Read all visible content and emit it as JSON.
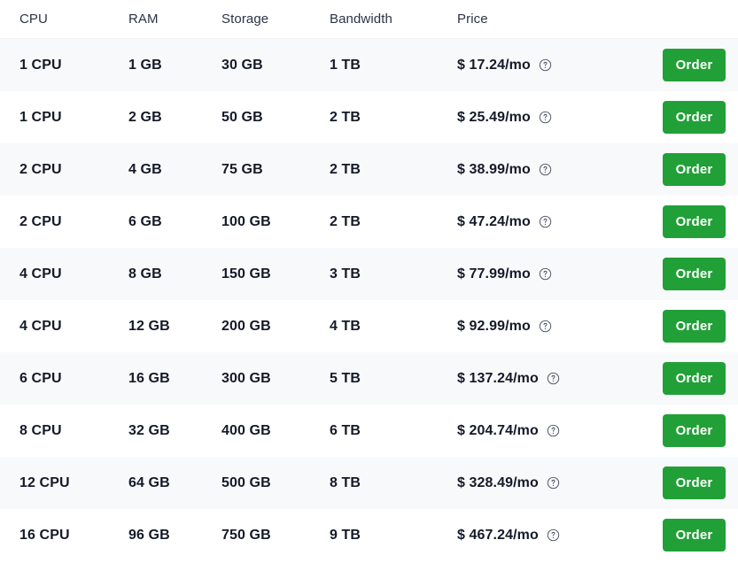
{
  "table": {
    "columns": [
      {
        "key": "cpu",
        "label": "CPU"
      },
      {
        "key": "ram",
        "label": "RAM"
      },
      {
        "key": "storage",
        "label": "Storage"
      },
      {
        "key": "bandwidth",
        "label": "Bandwidth"
      },
      {
        "key": "price",
        "label": "Price"
      }
    ],
    "action_label": "Order",
    "help_icon": "help-circle-icon",
    "currency_symbol": "$",
    "price_period": "/mo",
    "accent_color": "#21a038",
    "stripe_color": "#f8f9fa",
    "header_text_color": "#2b3445",
    "cell_text_color": "#151a28",
    "rows": [
      {
        "cpu": "1 CPU",
        "ram": "1 GB",
        "storage": "30 GB",
        "bandwidth": "1 TB",
        "price": "$ 17.24/mo",
        "price_value": "17.24",
        "action": "Order"
      },
      {
        "cpu": "1 CPU",
        "ram": "2 GB",
        "storage": "50 GB",
        "bandwidth": "2 TB",
        "price": "$ 25.49/mo",
        "price_value": "25.49",
        "action": "Order"
      },
      {
        "cpu": "2 CPU",
        "ram": "4 GB",
        "storage": "75 GB",
        "bandwidth": "2 TB",
        "price": "$ 38.99/mo",
        "price_value": "38.99",
        "action": "Order"
      },
      {
        "cpu": "2 CPU",
        "ram": "6 GB",
        "storage": "100 GB",
        "bandwidth": "2 TB",
        "price": "$ 47.24/mo",
        "price_value": "47.24",
        "action": "Order"
      },
      {
        "cpu": "4 CPU",
        "ram": "8 GB",
        "storage": "150 GB",
        "bandwidth": "3 TB",
        "price": "$ 77.99/mo",
        "price_value": "77.99",
        "action": "Order"
      },
      {
        "cpu": "4 CPU",
        "ram": "12 GB",
        "storage": "200 GB",
        "bandwidth": "4 TB",
        "price": "$ 92.99/mo",
        "price_value": "92.99",
        "action": "Order"
      },
      {
        "cpu": "6 CPU",
        "ram": "16 GB",
        "storage": "300 GB",
        "bandwidth": "5 TB",
        "price": "$ 137.24/mo",
        "price_value": "137.24",
        "action": "Order"
      },
      {
        "cpu": "8 CPU",
        "ram": "32 GB",
        "storage": "400 GB",
        "bandwidth": "6 TB",
        "price": "$ 204.74/mo",
        "price_value": "204.74",
        "action": "Order"
      },
      {
        "cpu": "12 CPU",
        "ram": "64 GB",
        "storage": "500 GB",
        "bandwidth": "8 TB",
        "price": "$ 328.49/mo",
        "price_value": "328.49",
        "action": "Order"
      },
      {
        "cpu": "16 CPU",
        "ram": "96 GB",
        "storage": "750 GB",
        "bandwidth": "9 TB",
        "price": "$ 467.24/mo",
        "price_value": "467.24",
        "action": "Order"
      }
    ]
  }
}
